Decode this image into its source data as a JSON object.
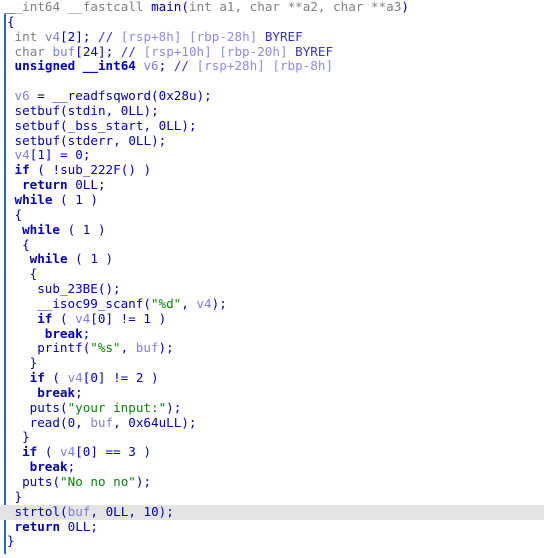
{
  "view": {
    "name": "pseudocode-view",
    "background": "#ffffff",
    "highlight_color": "#e4e4e4",
    "guide_color": "#1b6fc4",
    "colors": {
      "type": "#808080",
      "keyword": "#0000c0",
      "function": "#0000c0",
      "local_variable": "#8080e0",
      "string_literal": "#078607",
      "comment": "#3333cc",
      "comment_location": "#8c8ce8",
      "plain": "#000000"
    }
  },
  "code": {
    "language": "c-pseudocode",
    "highlighted_line_number": 35,
    "lines": [
      {
        "n": 1,
        "indent": 0,
        "highlight": false,
        "tokens": [
          {
            "t": "type",
            "v": "__int64 __fastcall "
          },
          {
            "t": "fn",
            "v": "main"
          },
          {
            "t": "punct",
            "v": "("
          },
          {
            "t": "type",
            "v": "int a1, char **a2, char **a3"
          },
          {
            "t": "punct",
            "v": ")"
          }
        ]
      },
      {
        "n": 2,
        "indent": 0,
        "highlight": false,
        "tokens": [
          {
            "t": "brace",
            "v": "{"
          }
        ]
      },
      {
        "n": 3,
        "indent": 1,
        "highlight": false,
        "tokens": [
          {
            "t": "type",
            "v": "int "
          },
          {
            "t": "local",
            "v": "v4"
          },
          {
            "t": "punct",
            "v": "["
          },
          {
            "t": "num",
            "v": "2"
          },
          {
            "t": "punct",
            "v": "]; "
          },
          {
            "t": "cmt",
            "v": "// "
          },
          {
            "t": "cmtloc",
            "v": "[rsp+8h] [rbp-28h] "
          },
          {
            "t": "cmt",
            "v": "BYREF"
          }
        ]
      },
      {
        "n": 4,
        "indent": 1,
        "highlight": false,
        "tokens": [
          {
            "t": "type",
            "v": "char "
          },
          {
            "t": "local",
            "v": "buf"
          },
          {
            "t": "punct",
            "v": "["
          },
          {
            "t": "num",
            "v": "24"
          },
          {
            "t": "punct",
            "v": "]; "
          },
          {
            "t": "cmt",
            "v": "// "
          },
          {
            "t": "cmtloc",
            "v": "[rsp+10h] [rbp-20h] "
          },
          {
            "t": "cmt",
            "v": "BYREF"
          }
        ]
      },
      {
        "n": 5,
        "indent": 1,
        "highlight": false,
        "tokens": [
          {
            "t": "kw",
            "v": "unsigned "
          },
          {
            "t": "kw",
            "v": "__int64 "
          },
          {
            "t": "local",
            "v": "v6"
          },
          {
            "t": "punct",
            "v": "; "
          },
          {
            "t": "cmt",
            "v": "// "
          },
          {
            "t": "cmtloc",
            "v": "[rsp+28h] [rbp-8h]"
          }
        ]
      },
      {
        "n": 6,
        "indent": 0,
        "highlight": false,
        "tokens": []
      },
      {
        "n": 7,
        "indent": 1,
        "highlight": false,
        "tokens": [
          {
            "t": "local",
            "v": "v6"
          },
          {
            "t": "plain",
            "v": " = "
          },
          {
            "t": "fn",
            "v": "__readfsqword"
          },
          {
            "t": "punct",
            "v": "("
          },
          {
            "t": "num",
            "v": "0x28u"
          },
          {
            "t": "punct",
            "v": ");"
          }
        ]
      },
      {
        "n": 8,
        "indent": 1,
        "highlight": false,
        "tokens": [
          {
            "t": "fn",
            "v": "setbuf"
          },
          {
            "t": "punct",
            "v": "("
          },
          {
            "t": "fn",
            "v": "stdin"
          },
          {
            "t": "punct",
            "v": ", "
          },
          {
            "t": "num",
            "v": "0LL"
          },
          {
            "t": "punct",
            "v": ");"
          }
        ]
      },
      {
        "n": 9,
        "indent": 1,
        "highlight": false,
        "tokens": [
          {
            "t": "fn",
            "v": "setbuf"
          },
          {
            "t": "punct",
            "v": "("
          },
          {
            "t": "fn",
            "v": "_bss_start"
          },
          {
            "t": "punct",
            "v": ", "
          },
          {
            "t": "num",
            "v": "0LL"
          },
          {
            "t": "punct",
            "v": ");"
          }
        ]
      },
      {
        "n": 10,
        "indent": 1,
        "highlight": false,
        "tokens": [
          {
            "t": "fn",
            "v": "setbuf"
          },
          {
            "t": "punct",
            "v": "("
          },
          {
            "t": "fn",
            "v": "stderr"
          },
          {
            "t": "punct",
            "v": ", "
          },
          {
            "t": "num",
            "v": "0LL"
          },
          {
            "t": "punct",
            "v": ");"
          }
        ]
      },
      {
        "n": 11,
        "indent": 1,
        "highlight": false,
        "tokens": [
          {
            "t": "local",
            "v": "v4"
          },
          {
            "t": "punct",
            "v": "["
          },
          {
            "t": "num",
            "v": "1"
          },
          {
            "t": "punct",
            "v": "] = "
          },
          {
            "t": "num",
            "v": "0"
          },
          {
            "t": "punct",
            "v": ";"
          }
        ]
      },
      {
        "n": 12,
        "indent": 1,
        "highlight": false,
        "tokens": [
          {
            "t": "kw",
            "v": "if"
          },
          {
            "t": "punct",
            "v": " ( !"
          },
          {
            "t": "fn",
            "v": "sub_222F"
          },
          {
            "t": "punct",
            "v": "() )"
          }
        ]
      },
      {
        "n": 13,
        "indent": 2,
        "highlight": false,
        "tokens": [
          {
            "t": "kw",
            "v": "return"
          },
          {
            "t": "punct",
            "v": " "
          },
          {
            "t": "num",
            "v": "0LL"
          },
          {
            "t": "punct",
            "v": ";"
          }
        ]
      },
      {
        "n": 14,
        "indent": 1,
        "highlight": false,
        "tokens": [
          {
            "t": "kw",
            "v": "while"
          },
          {
            "t": "punct",
            "v": " ( "
          },
          {
            "t": "num",
            "v": "1"
          },
          {
            "t": "punct",
            "v": " )"
          }
        ]
      },
      {
        "n": 15,
        "indent": 1,
        "highlight": false,
        "tokens": [
          {
            "t": "brace",
            "v": "{"
          }
        ]
      },
      {
        "n": 16,
        "indent": 2,
        "highlight": false,
        "tokens": [
          {
            "t": "kw",
            "v": "while"
          },
          {
            "t": "punct",
            "v": " ( "
          },
          {
            "t": "num",
            "v": "1"
          },
          {
            "t": "punct",
            "v": " )"
          }
        ]
      },
      {
        "n": 17,
        "indent": 2,
        "highlight": false,
        "tokens": [
          {
            "t": "brace",
            "v": "{"
          }
        ]
      },
      {
        "n": 18,
        "indent": 3,
        "highlight": false,
        "tokens": [
          {
            "t": "kw",
            "v": "while"
          },
          {
            "t": "punct",
            "v": " ( "
          },
          {
            "t": "num",
            "v": "1"
          },
          {
            "t": "punct",
            "v": " )"
          }
        ]
      },
      {
        "n": 19,
        "indent": 3,
        "highlight": false,
        "tokens": [
          {
            "t": "brace",
            "v": "{"
          }
        ]
      },
      {
        "n": 20,
        "indent": 4,
        "highlight": false,
        "tokens": [
          {
            "t": "fn",
            "v": "sub_23BE"
          },
          {
            "t": "punct",
            "v": "();"
          }
        ]
      },
      {
        "n": 21,
        "indent": 4,
        "highlight": false,
        "tokens": [
          {
            "t": "fn",
            "v": "__isoc99_scanf"
          },
          {
            "t": "punct",
            "v": "("
          },
          {
            "t": "str",
            "v": "\"%d\""
          },
          {
            "t": "punct",
            "v": ", "
          },
          {
            "t": "local",
            "v": "v4"
          },
          {
            "t": "punct",
            "v": ");"
          }
        ]
      },
      {
        "n": 22,
        "indent": 4,
        "highlight": false,
        "tokens": [
          {
            "t": "kw",
            "v": "if"
          },
          {
            "t": "punct",
            "v": " ( "
          },
          {
            "t": "local",
            "v": "v4"
          },
          {
            "t": "punct",
            "v": "["
          },
          {
            "t": "num",
            "v": "0"
          },
          {
            "t": "punct",
            "v": "] != "
          },
          {
            "t": "num",
            "v": "1"
          },
          {
            "t": "punct",
            "v": " )"
          }
        ]
      },
      {
        "n": 23,
        "indent": 5,
        "highlight": false,
        "tokens": [
          {
            "t": "kw",
            "v": "break"
          },
          {
            "t": "punct",
            "v": ";"
          }
        ]
      },
      {
        "n": 24,
        "indent": 4,
        "highlight": false,
        "tokens": [
          {
            "t": "fn",
            "v": "printf"
          },
          {
            "t": "punct",
            "v": "("
          },
          {
            "t": "str",
            "v": "\"%s\""
          },
          {
            "t": "punct",
            "v": ", "
          },
          {
            "t": "local",
            "v": "buf"
          },
          {
            "t": "punct",
            "v": ");"
          }
        ]
      },
      {
        "n": 25,
        "indent": 3,
        "highlight": false,
        "tokens": [
          {
            "t": "brace",
            "v": "}"
          }
        ]
      },
      {
        "n": 26,
        "indent": 3,
        "highlight": false,
        "tokens": [
          {
            "t": "kw",
            "v": "if"
          },
          {
            "t": "punct",
            "v": " ( "
          },
          {
            "t": "local",
            "v": "v4"
          },
          {
            "t": "punct",
            "v": "["
          },
          {
            "t": "num",
            "v": "0"
          },
          {
            "t": "punct",
            "v": "] != "
          },
          {
            "t": "num",
            "v": "2"
          },
          {
            "t": "punct",
            "v": " )"
          }
        ]
      },
      {
        "n": 27,
        "indent": 4,
        "highlight": false,
        "tokens": [
          {
            "t": "kw",
            "v": "break"
          },
          {
            "t": "punct",
            "v": ";"
          }
        ]
      },
      {
        "n": 28,
        "indent": 3,
        "highlight": false,
        "tokens": [
          {
            "t": "fn",
            "v": "puts"
          },
          {
            "t": "punct",
            "v": "("
          },
          {
            "t": "str",
            "v": "\"your input:\""
          },
          {
            "t": "punct",
            "v": ");"
          }
        ]
      },
      {
        "n": 29,
        "indent": 3,
        "highlight": false,
        "tokens": [
          {
            "t": "fn",
            "v": "read"
          },
          {
            "t": "punct",
            "v": "("
          },
          {
            "t": "num",
            "v": "0"
          },
          {
            "t": "punct",
            "v": ", "
          },
          {
            "t": "local",
            "v": "buf"
          },
          {
            "t": "punct",
            "v": ", "
          },
          {
            "t": "num",
            "v": "0x64uLL"
          },
          {
            "t": "punct",
            "v": ");"
          }
        ]
      },
      {
        "n": 30,
        "indent": 2,
        "highlight": false,
        "tokens": [
          {
            "t": "brace",
            "v": "}"
          }
        ]
      },
      {
        "n": 31,
        "indent": 2,
        "highlight": false,
        "tokens": [
          {
            "t": "kw",
            "v": "if"
          },
          {
            "t": "punct",
            "v": " ( "
          },
          {
            "t": "local",
            "v": "v4"
          },
          {
            "t": "punct",
            "v": "["
          },
          {
            "t": "num",
            "v": "0"
          },
          {
            "t": "punct",
            "v": "] == "
          },
          {
            "t": "num",
            "v": "3"
          },
          {
            "t": "punct",
            "v": " )"
          }
        ]
      },
      {
        "n": 32,
        "indent": 3,
        "highlight": false,
        "tokens": [
          {
            "t": "kw",
            "v": "break"
          },
          {
            "t": "punct",
            "v": ";"
          }
        ]
      },
      {
        "n": 33,
        "indent": 2,
        "highlight": false,
        "tokens": [
          {
            "t": "fn",
            "v": "puts"
          },
          {
            "t": "punct",
            "v": "("
          },
          {
            "t": "str",
            "v": "\"No no no\""
          },
          {
            "t": "punct",
            "v": ");"
          }
        ]
      },
      {
        "n": 34,
        "indent": 1,
        "highlight": false,
        "tokens": [
          {
            "t": "brace",
            "v": "}"
          }
        ]
      },
      {
        "n": 35,
        "indent": 1,
        "highlight": true,
        "tokens": [
          {
            "t": "fn",
            "v": "strtol"
          },
          {
            "t": "punct",
            "v": "("
          },
          {
            "t": "local",
            "v": "buf"
          },
          {
            "t": "punct",
            "v": ", "
          },
          {
            "t": "num",
            "v": "0LL"
          },
          {
            "t": "punct",
            "v": ", "
          },
          {
            "t": "num",
            "v": "10"
          },
          {
            "t": "punct",
            "v": ");"
          }
        ]
      },
      {
        "n": 36,
        "indent": 1,
        "highlight": false,
        "tokens": [
          {
            "t": "kw",
            "v": "return"
          },
          {
            "t": "punct",
            "v": " "
          },
          {
            "t": "num",
            "v": "0LL"
          },
          {
            "t": "punct",
            "v": ";"
          }
        ]
      },
      {
        "n": 37,
        "indent": 0,
        "highlight": false,
        "tokens": [
          {
            "t": "brace",
            "v": "}"
          }
        ]
      }
    ]
  }
}
